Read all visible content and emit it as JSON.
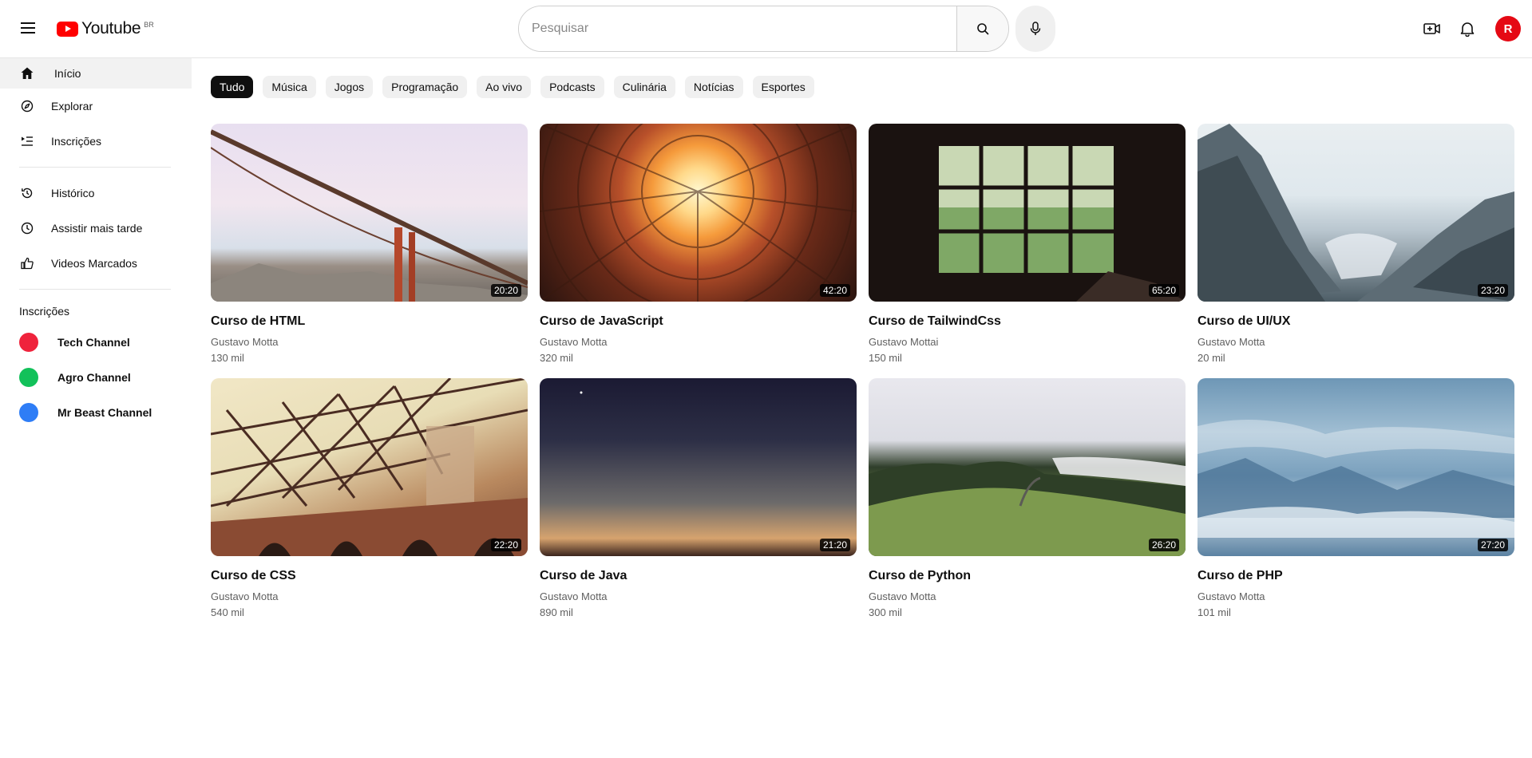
{
  "header": {
    "logo_text": "Youtube",
    "logo_region": "BR",
    "search_placeholder": "Pesquisar",
    "avatar_letter": "R",
    "icons": [
      "menu-icon",
      "search-icon",
      "microphone-icon",
      "video-add-icon",
      "bell-icon"
    ]
  },
  "sidebar": {
    "main": [
      {
        "label": "Início",
        "icon": "home-icon"
      },
      {
        "label": "Explorar",
        "icon": "compass-icon"
      },
      {
        "label": "Inscrições",
        "icon": "subscriptions-icon"
      }
    ],
    "library": [
      {
        "label": "Histórico",
        "icon": "history-icon"
      },
      {
        "label": "Assistir mais tarde",
        "icon": "clock-icon"
      },
      {
        "label": "Videos Marcados",
        "icon": "thumbs-up-icon"
      }
    ],
    "subscriptions_heading": "Inscrições",
    "channels": [
      {
        "label": "Tech Channel",
        "color": "#ef233c"
      },
      {
        "label": "Agro Channel",
        "color": "#12c15a"
      },
      {
        "label": "Mr Beast Channel",
        "color": "#2e7df6"
      }
    ]
  },
  "chips": [
    "Tudo",
    "Música",
    "Jogos",
    "Programação",
    "Ao vivo",
    "Podcasts",
    "Culinária",
    "Notícias",
    "Esportes"
  ],
  "videos": [
    {
      "title": "Curso de HTML",
      "channel": "Gustavo Motta",
      "views": "130 mil",
      "duration": "20:20"
    },
    {
      "title": "Curso de JavaScript",
      "channel": "Gustavo Motta",
      "views": "320 mil",
      "duration": "42:20"
    },
    {
      "title": "Curso de TailwindCss",
      "channel": "Gustavo Mottai",
      "views": "150 mil",
      "duration": "65:20"
    },
    {
      "title": "Curso de UI/UX",
      "channel": "Gustavo Motta",
      "views": "20 mil",
      "duration": "23:20"
    },
    {
      "title": "Curso de CSS",
      "channel": "Gustavo Motta",
      "views": "540 mil",
      "duration": "22:20"
    },
    {
      "title": "Curso de Java",
      "channel": "Gustavo Motta",
      "views": "890 mil",
      "duration": "21:20"
    },
    {
      "title": "Curso de Python",
      "channel": "Gustavo Motta",
      "views": "300 mil",
      "duration": "26:20"
    },
    {
      "title": "Curso de PHP",
      "channel": "Gustavo Motta",
      "views": "101 mil",
      "duration": "27:20"
    }
  ],
  "colors": {
    "brand": "#ff0000",
    "avatar": "#e50914",
    "active_chip": "#0f0f0f"
  }
}
